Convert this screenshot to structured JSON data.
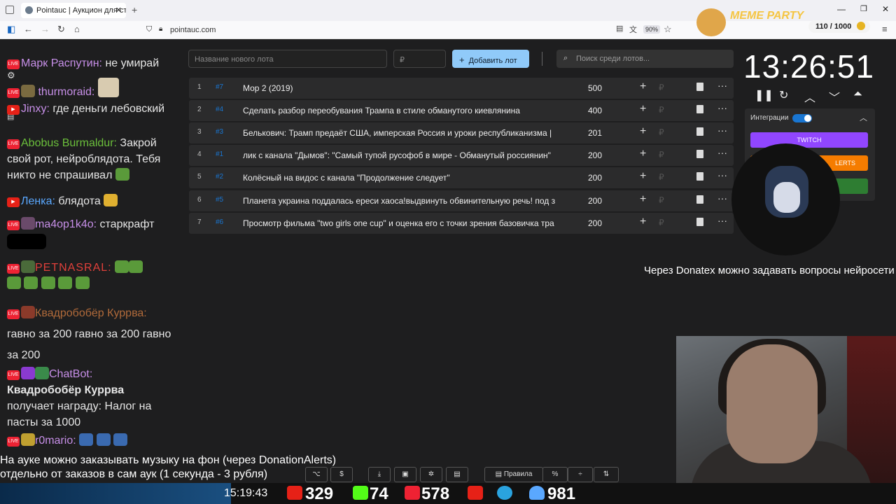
{
  "browser": {
    "tab_title": "Pointauc | Аукцион для стрима",
    "url": "pointauc.com",
    "zoom": "90%",
    "new_tab": "+"
  },
  "lot_form": {
    "name_placeholder": "Название нового лота",
    "amount_placeholder": "₽",
    "add_label": "Добавить лот",
    "search_placeholder": "Поиск среди лотов..."
  },
  "lots": [
    {
      "n": "1",
      "id": "#7",
      "name": "Мор 2 (2019)",
      "amount": "500"
    },
    {
      "n": "2",
      "id": "#4",
      "name": "Сделать разбор переобувания Трампа в стиле обманутого киевлянина",
      "amount": "400"
    },
    {
      "n": "3",
      "id": "#3",
      "name": "Белькович: Трамп предаёт США, имперская Россия и уроки республиканизма |",
      "amount": "201"
    },
    {
      "n": "4",
      "id": "#1",
      "name": "лик с канала \"Дымов\": \"Самый тупой русофоб в мире - Обманутый россиянин\"",
      "amount": "200"
    },
    {
      "n": "5",
      "id": "#2",
      "name": "Колёсный на видос с канала \"Продолжение следует\"",
      "amount": "200"
    },
    {
      "n": "6",
      "id": "#5",
      "name": "Планета украина поддалась ереси хаоса!выдвинуть обвинительную речь! под з",
      "amount": "200"
    },
    {
      "n": "7",
      "id": "#6",
      "name": "Просмотр фильма \"two girls one cup\" и оценка его с точки зрения базовичка тра",
      "amount": "200"
    }
  ],
  "row_icons": {
    "plus": "+",
    "rub": "₽",
    "dots": "···"
  },
  "timer": "13:26:51",
  "integrations": {
    "label": "Интеграции",
    "twitch": "TWITCH",
    "alerts": "LERTS"
  },
  "chat": [
    {
      "user": "Марк Распутин:",
      "text": "не умирай",
      "user_color": "#c78fe8"
    },
    {
      "user": "thurmoraid:",
      "text": "",
      "user_color": "#c78fe8"
    },
    {
      "user": "Jinxy:",
      "text": "где деньги лебовский",
      "user_color": "#c78fe8"
    },
    {
      "user": "Abobus Burmaldur:",
      "text": "Закрой свой рот, нейроблядота. Тебя никто не спрашивал",
      "user_color": "#6bbf3b"
    },
    {
      "user": "Ленка:",
      "text": "блядота",
      "user_color": "#5aa8ff"
    },
    {
      "user": "ma4op1k4o:",
      "text": "старкрафт",
      "user_color": "#c78fe8"
    },
    {
      "user": "PETNASRAL:",
      "text": "",
      "user_color": "#e0403a"
    },
    {
      "user": "Квадробобёр Куррва:",
      "text": "гавно за 200 гавно за 200 гавно за 200",
      "user_color": "#b06a3a"
    },
    {
      "user": "ChatBot:",
      "text": "получает награду: Налог на пасты за 1000",
      "user_color": "#c78fe8",
      "highlight": "Квадробобёр Куррва"
    },
    {
      "user": "r0mario:",
      "text": "",
      "user_color": "#c78fe8"
    }
  ],
  "overlay": {
    "donatex": "Через Donatex можно задавать вопросы нейросети",
    "music_line1": "На ауке можно заказывать музыку на фон (через DonationAlerts)",
    "music_line2": "отдельно от заказов в сам аук (1 секунда - 3 рубля)"
  },
  "toolbar": {
    "rules": "Правила",
    "percent": "%",
    "dollar": "$"
  },
  "status": {
    "time": "15:19:43",
    "youtube": "329",
    "kick": "74",
    "live": "578",
    "telegram": "981"
  },
  "meme_party": {
    "title": "MEME PARTY",
    "count": "110 / 1000"
  },
  "colors": {
    "accent": "#90caf9",
    "twitch": "#9146ff",
    "alerts": "#f57c00",
    "green": "#2e7d32"
  }
}
